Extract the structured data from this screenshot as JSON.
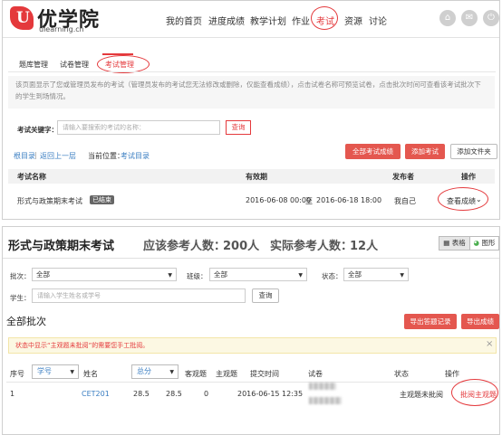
{
  "header": {
    "logo_mark": "U",
    "logo_text": "优学院",
    "logo_sub": "ulearning.cn",
    "nav": [
      "我的首页",
      "进度成绩",
      "教学计划",
      "作业",
      "考试",
      "资源",
      "讨论"
    ],
    "active_nav": "考试",
    "icons": [
      "home-icon",
      "mail-icon",
      "power-icon"
    ]
  },
  "subtabs": [
    "题库管理",
    "试卷管理",
    "考试管理"
  ],
  "notice": "该页面显示了您或管理员发布的考试（管理员发布的考试您无法修改或删除，仅能查看成绩），点击试卷名称可预览试卷，点击批次时间可查看该考试批次下的学生到场情况。",
  "search": {
    "label": "考试关键字：",
    "placeholder": "请输入要搜索的考试的名称：",
    "button": "查询"
  },
  "breadcrumb": {
    "root": "根目录",
    "up": "返回上一层",
    "current_label": "当前位置：",
    "current": "考试目录"
  },
  "actions": {
    "all_scores": "全部考试成绩",
    "add_exam": "添加考试",
    "add_folder": "添加文件夹"
  },
  "exam_table": {
    "headers": [
      "考试名称",
      "有效期",
      "发布者",
      "操作"
    ],
    "row": {
      "name": "形式与政策期末考试",
      "status": "已结束",
      "start": "2016-06-08 00:00",
      "to": "至",
      "end": "2016-06-18 18:00",
      "publisher": "我自己",
      "action": "查看成绩"
    }
  },
  "detail": {
    "title": "形式与政策期末考试",
    "expected_label": "应该参考人数：",
    "expected": "200人",
    "actual_label": "实际参考人数：",
    "actual": "12人",
    "view_table": "表格",
    "view_chart": "图形"
  },
  "filters": {
    "batch_label": "批次：",
    "batch_value": "全部",
    "class_label": "班级：",
    "class_value": "全部",
    "status_label": "状态：",
    "status_value": "全部",
    "student_label": "学生：",
    "student_placeholder": "请输入学生姓名或学号",
    "search_button": "查询"
  },
  "batch": {
    "title": "全部批次",
    "export_answers": "导出答题记录",
    "export_scores": "导出成绩",
    "warning": "状态中显示“主观题未批阅”的需要您手工批阅。",
    "warning_close": "×"
  },
  "score_table": {
    "headers": [
      "序号",
      "学号",
      "姓名",
      "总分",
      "客观题",
      "主观题",
      "提交时间",
      "试卷",
      "状态",
      "操作"
    ],
    "rows": [
      {
        "index": "1",
        "id": "",
        "name": "CET201",
        "total": "28.5",
        "objective": "28.5",
        "subjective": "0",
        "submit_time": "2016-06-15 12:35",
        "status": "主观题未批阅",
        "action": "批阅主观题"
      }
    ]
  }
}
